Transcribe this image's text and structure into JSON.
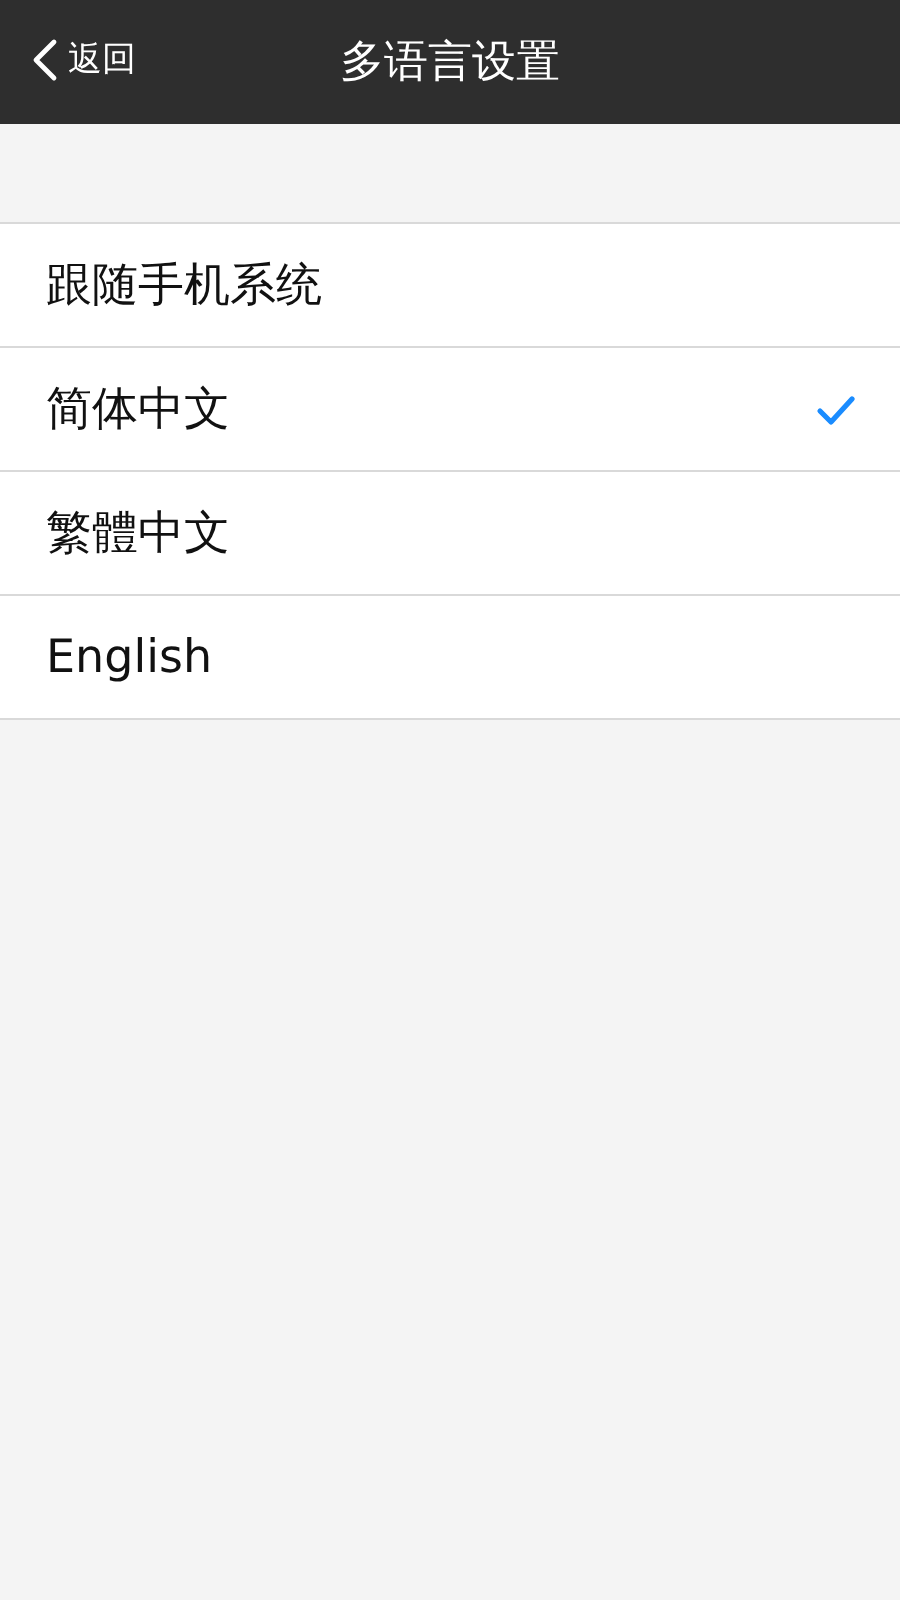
{
  "nav_bar": {
    "back": "返回",
    "title": "多语言设置"
  },
  "languages": [
    {
      "label": "跟随手机系统",
      "selected": false
    },
    {
      "label": "简体中文",
      "selected": true
    },
    {
      "label": "繁體中文",
      "selected": false
    },
    {
      "label": "English",
      "selected": false
    }
  ]
}
